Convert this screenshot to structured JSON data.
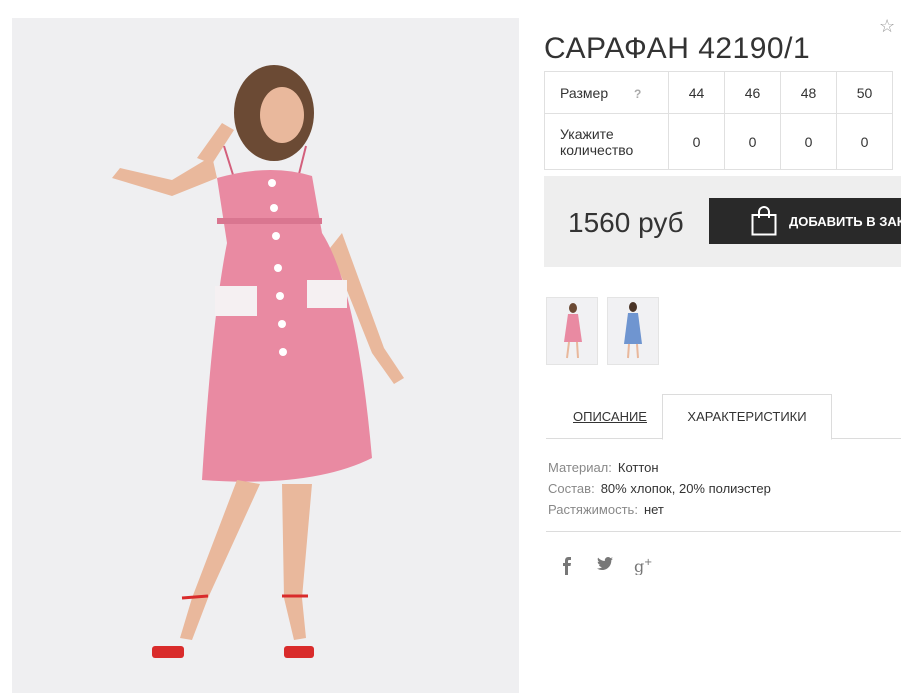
{
  "product": {
    "title": "САРАФАН 42190/1",
    "price": "1560 руб"
  },
  "sizes": {
    "label": "Размер",
    "help": "?",
    "values": [
      "44",
      "46",
      "48",
      "50"
    ],
    "qty_label": "Укажите количество",
    "quantities": [
      "0",
      "0",
      "0",
      "0"
    ]
  },
  "buttons": {
    "add_to_cart": "ДОБАВИТЬ В ЗАКАЗ"
  },
  "tabs": {
    "description": "ОПИСАНИЕ",
    "characteristics": "ХАРАКТЕРИСТИКИ"
  },
  "specs": [
    {
      "key": "Материал:",
      "value": "Коттон"
    },
    {
      "key": "Состав:",
      "value": "80% хлопок, 20% полиэстер"
    },
    {
      "key": "Растяжимость:",
      "value": "нет"
    }
  ],
  "icons": {
    "favorite": "star-outline-icon",
    "help": "question-icon",
    "cart": "shopping-bag-icon",
    "social": [
      "facebook-icon",
      "twitter-icon",
      "google-plus-icon"
    ]
  },
  "colors": {
    "dress_pink": "#e98aa2",
    "dress_blue": "#6f95d0",
    "button_dark": "#292929",
    "price_bar": "#eeeeee"
  }
}
